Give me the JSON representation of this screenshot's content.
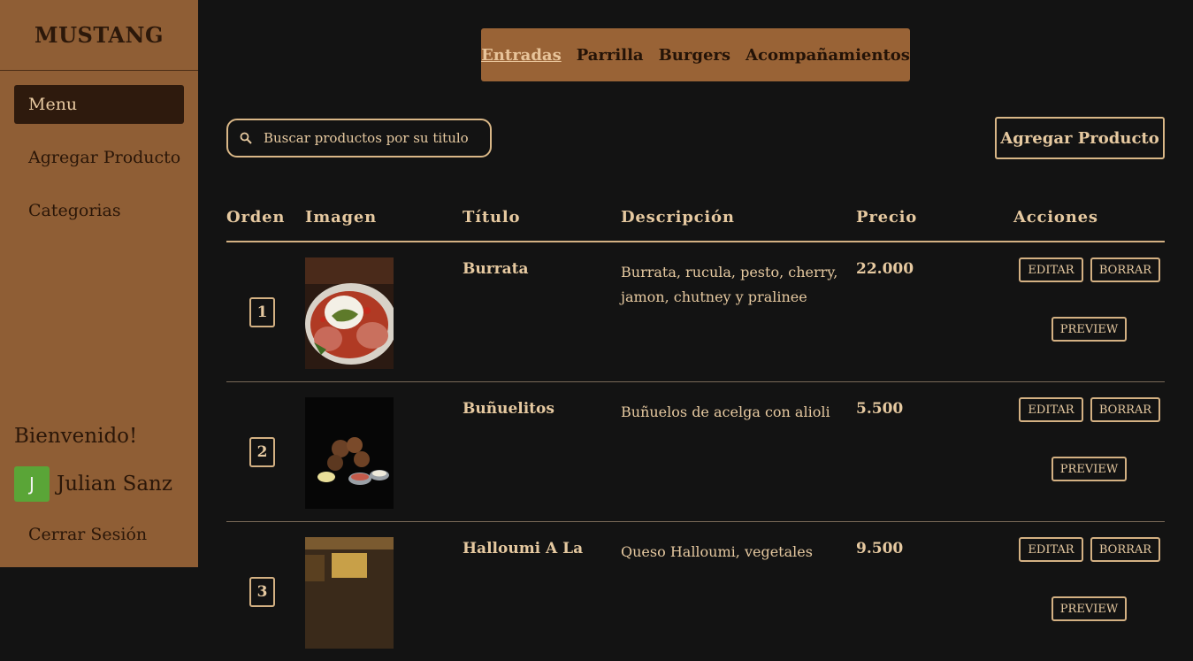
{
  "sidebar": {
    "brand": "MUSTANG",
    "items": [
      {
        "label": "Menu",
        "active": true
      },
      {
        "label": "Agregar Producto",
        "active": false
      },
      {
        "label": "Categorias",
        "active": false
      }
    ],
    "welcome": "Bienvenido!",
    "user": {
      "initial": "J",
      "name": "Julian Sanz"
    },
    "logout": "Cerrar Sesión"
  },
  "tabs": [
    {
      "label": "Entradas",
      "active": true
    },
    {
      "label": "Parrilla",
      "active": false
    },
    {
      "label": "Burgers",
      "active": false
    },
    {
      "label": "Acompañamientos",
      "active": false
    }
  ],
  "search": {
    "placeholder": "Buscar productos por su titulo",
    "value": ""
  },
  "add_button": "Agregar Producto",
  "table": {
    "headers": [
      "Orden",
      "Imagen",
      "Título",
      "Descripción",
      "Precio",
      "Acciones"
    ],
    "rows": [
      {
        "order": "1",
        "title": "Burrata",
        "description": "Burrata, rucula, pesto, cherry, jamon, chutney y pralinee",
        "price": "22.000",
        "image": "burrata-plate"
      },
      {
        "order": "2",
        "title": "Buñuelitos",
        "description": "Buñuelos de acelga con alioli",
        "price": "5.500",
        "image": "bunuelitos-plate"
      },
      {
        "order": "3",
        "title": "Halloumi A La",
        "description": "Queso Halloumi, vegetales",
        "price": "9.500",
        "image": "halloumi-plate"
      }
    ],
    "actions": {
      "edit": "EDITAR",
      "delete": "BORRAR",
      "preview": "PREVIEW"
    }
  },
  "colors": {
    "sidebar_bg": "#8f5e35",
    "tabs_bg": "#996336",
    "main_bg": "#131313",
    "accent": "#e6c9a0",
    "avatar": "#5aa537"
  }
}
